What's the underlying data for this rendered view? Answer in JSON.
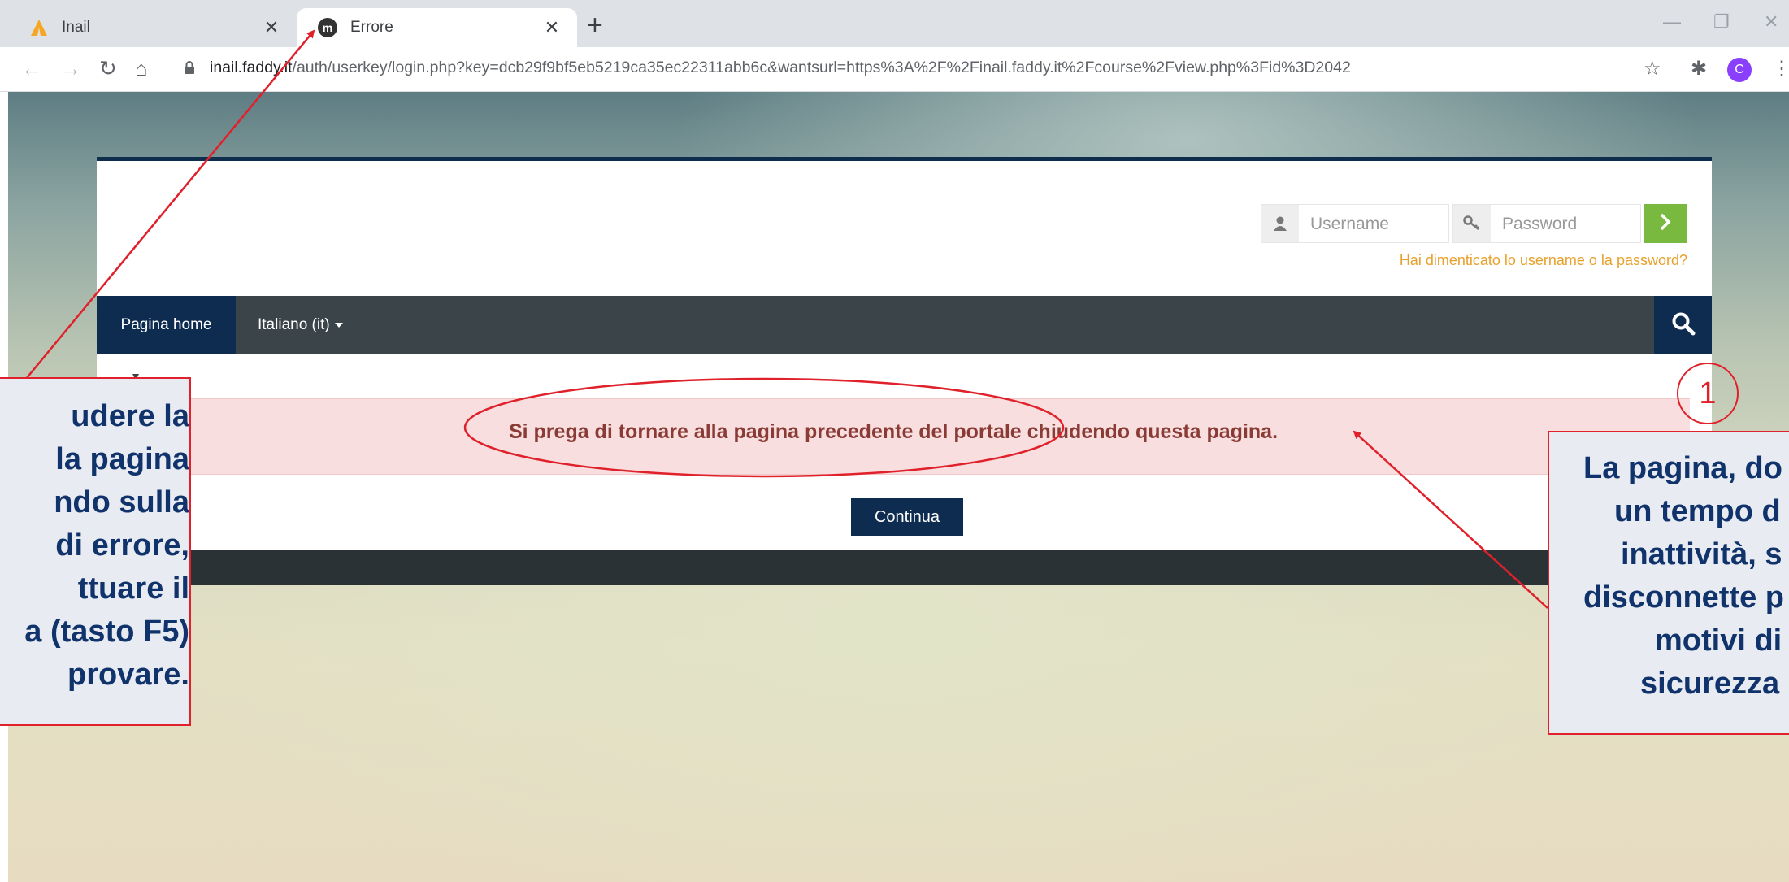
{
  "browser": {
    "tabs": [
      {
        "title": "Inail",
        "icon": "inail-logo-icon",
        "active": false
      },
      {
        "title": "Errore",
        "icon": "moodle-logo-icon",
        "active": true
      }
    ],
    "new_tab_label": "+",
    "address": {
      "host": "inail.faddy.it",
      "path": "/auth/userkey/login.php?key=dcb29f9bf5eb5219ca35ec22311abb6c&wantsurl=https%3A%2F%2Finail.faddy.it%2Fcourse%2Fview.php%3Fid%3D2042"
    },
    "profile_initial": "C"
  },
  "header": {
    "username_placeholder": "Username",
    "password_placeholder": "Password",
    "forgot_link": "Hai dimenticato lo username o la password?"
  },
  "nav": {
    "home": "Pagina home",
    "language": "Italiano (it)"
  },
  "alert": {
    "message": "Si prega di tornare alla pagina precedente del portale chiudendo questa pagina."
  },
  "continue_label": "Continua",
  "annotations": {
    "left_lines": [
      "udere la",
      "la pagina",
      "ndo sulla",
      "di errore,",
      "ttuare il",
      "a (tasto F5)",
      "provare."
    ],
    "right_lines": [
      "La pagina, do",
      "un tempo d",
      "inattività, s",
      "disconnette p",
      "motivi di",
      "sicurezza"
    ],
    "step_number": "1"
  },
  "colors": {
    "annotation_red": "#e0202a",
    "annotation_text": "#10336b",
    "alert_bg": "#f8dede",
    "alert_text": "#8a3b36",
    "primary": "#0d2c50",
    "submit_green": "#7ab93f",
    "forgot_link": "#e8a02b"
  }
}
